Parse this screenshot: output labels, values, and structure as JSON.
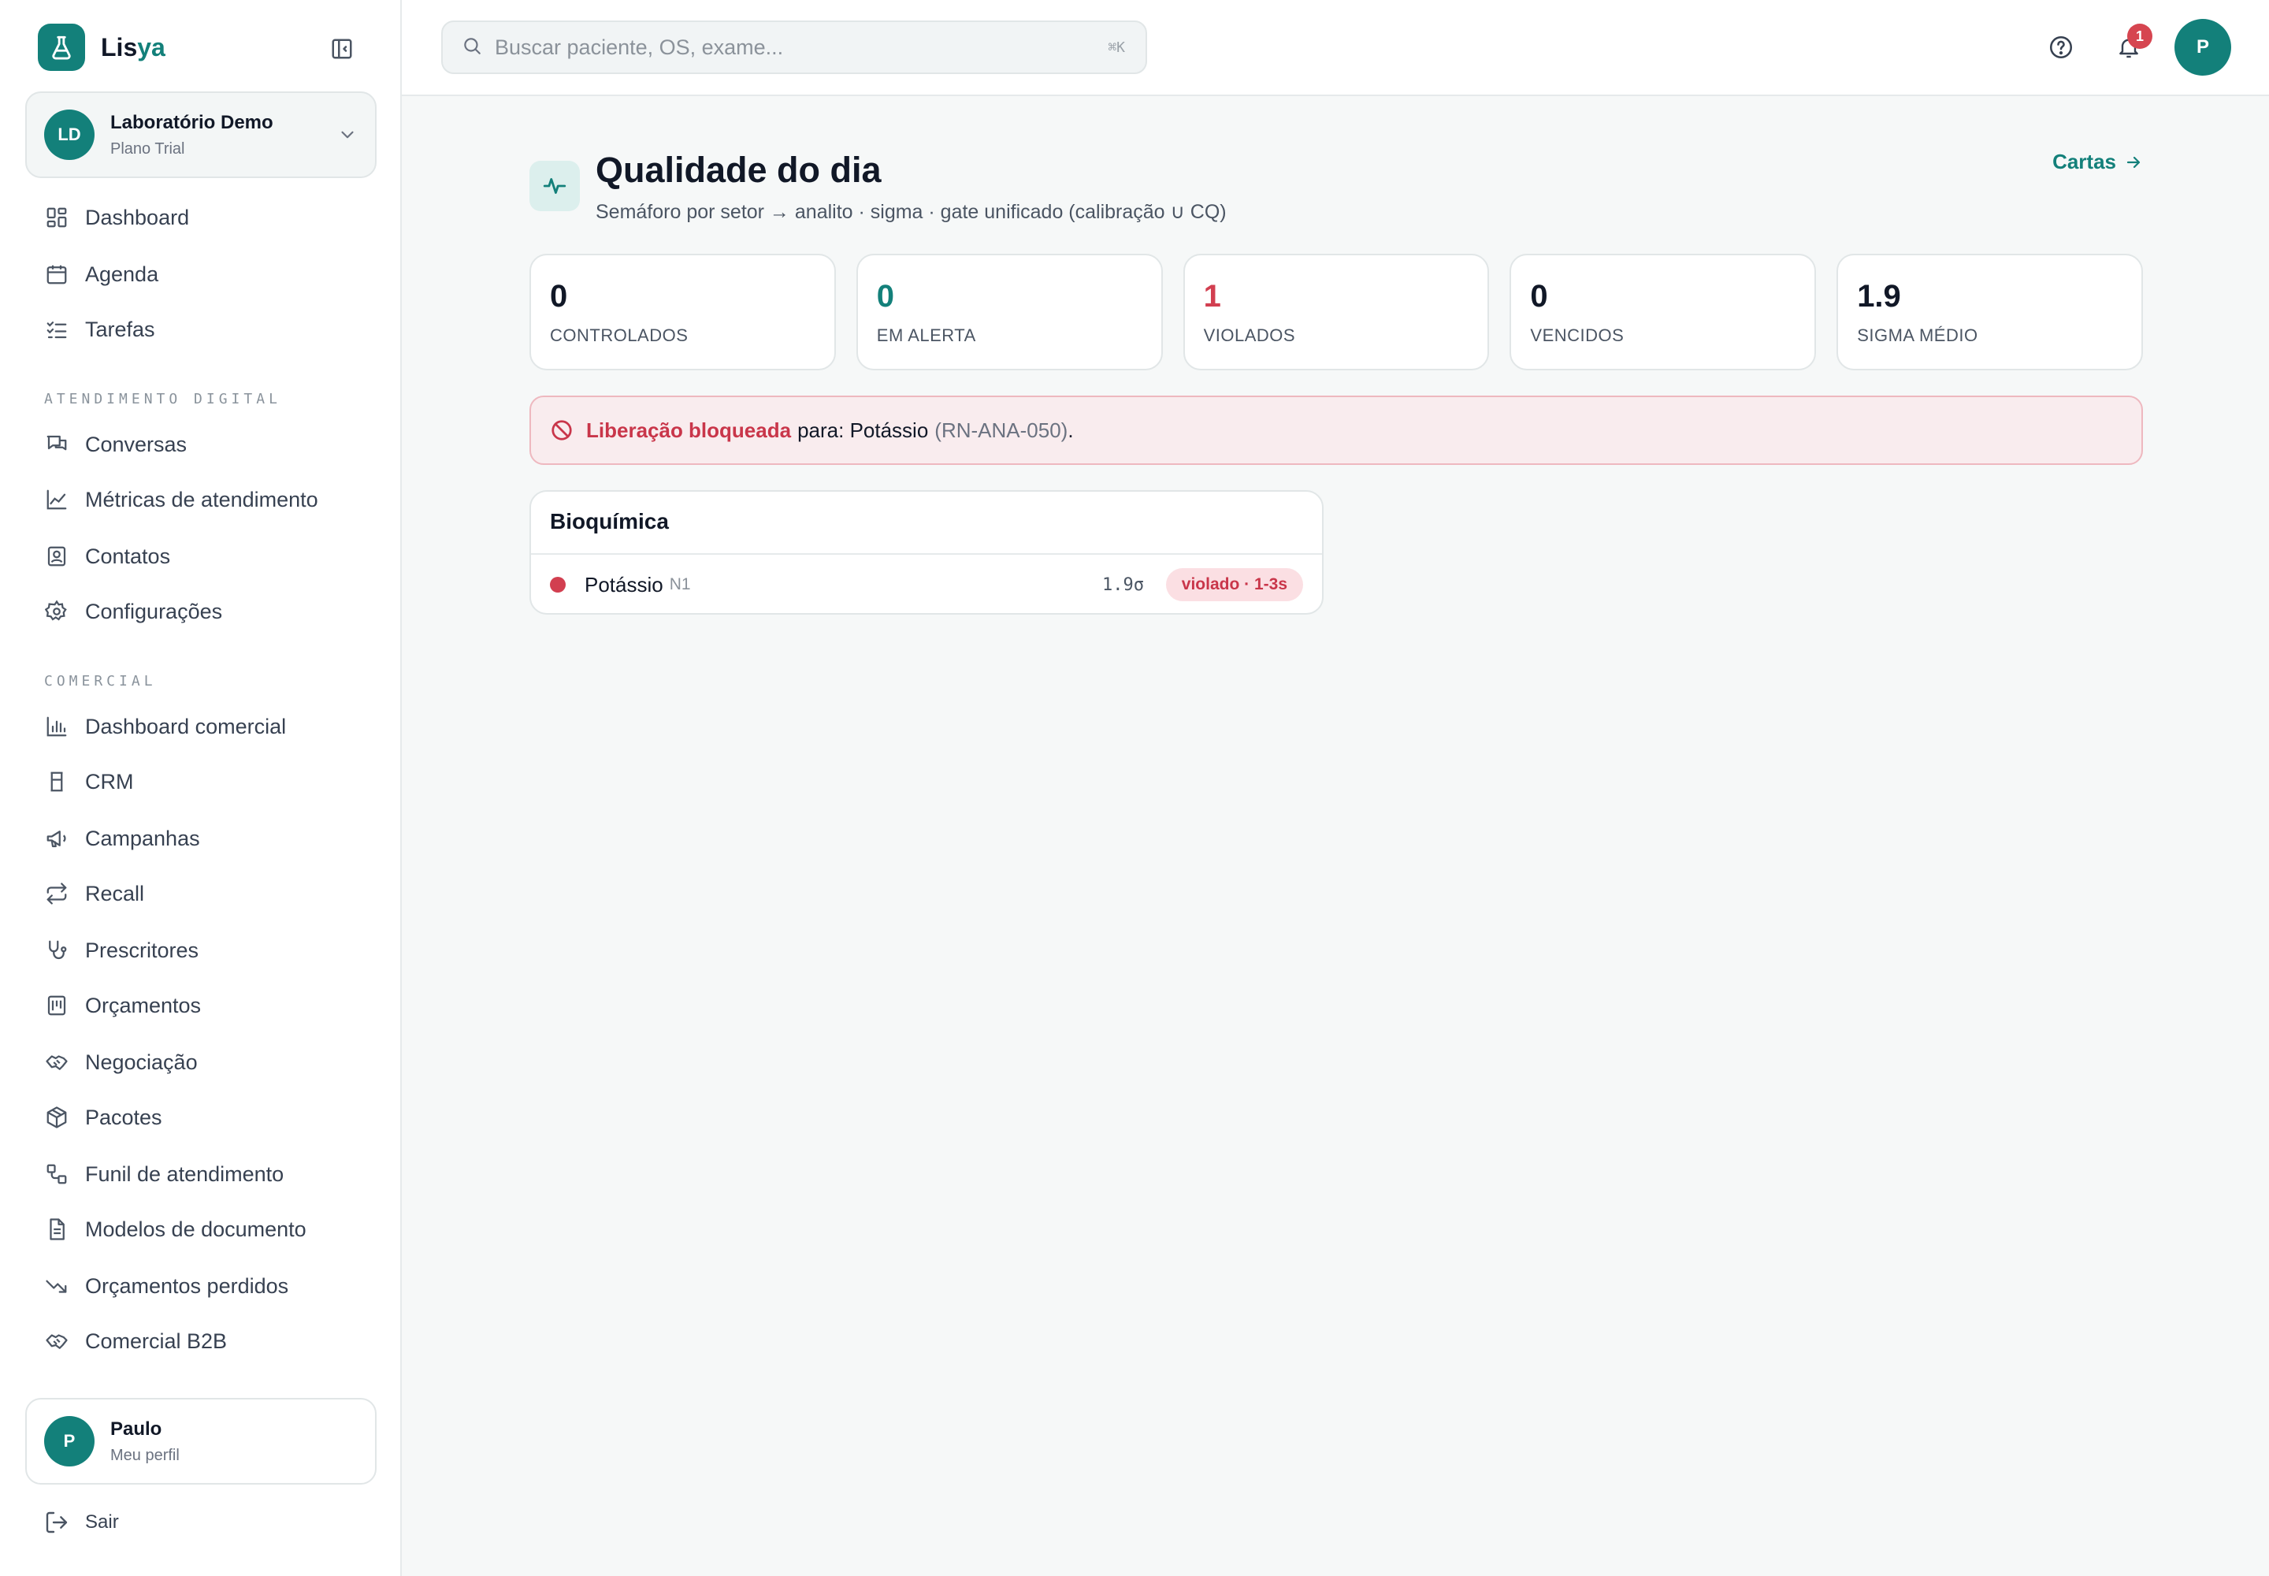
{
  "brand": {
    "name_part1": "Lis",
    "name_part2": "ya"
  },
  "org": {
    "initials": "LD",
    "name": "Laboratório Demo",
    "plan": "Plano Trial"
  },
  "nav": {
    "main": [
      {
        "label": "Dashboard",
        "icon": "dashboard-icon"
      },
      {
        "label": "Agenda",
        "icon": "calendar-icon"
      },
      {
        "label": "Tarefas",
        "icon": "checklist-icon"
      }
    ],
    "digital_title": "ATENDIMENTO DIGITAL",
    "digital": [
      {
        "label": "Conversas",
        "icon": "chat-icon"
      },
      {
        "label": "Métricas de atendimento",
        "icon": "line-chart-icon"
      },
      {
        "label": "Contatos",
        "icon": "contact-icon"
      },
      {
        "label": "Configurações",
        "icon": "gear-icon"
      }
    ],
    "commercial_title": "COMERCIAL",
    "commercial": [
      {
        "label": "Dashboard comercial",
        "icon": "bar-chart-icon"
      },
      {
        "label": "CRM",
        "icon": "crm-icon"
      },
      {
        "label": "Campanhas",
        "icon": "megaphone-icon"
      },
      {
        "label": "Recall",
        "icon": "repeat-icon"
      },
      {
        "label": "Prescritores",
        "icon": "stethoscope-icon"
      },
      {
        "label": "Orçamentos",
        "icon": "receipt-icon"
      },
      {
        "label": "Negociação",
        "icon": "handshake-icon"
      },
      {
        "label": "Pacotes",
        "icon": "package-icon"
      },
      {
        "label": "Funil de atendimento",
        "icon": "funnel-icon"
      },
      {
        "label": "Modelos de documento",
        "icon": "document-icon"
      },
      {
        "label": "Orçamentos perdidos",
        "icon": "trending-down-icon"
      },
      {
        "label": "Comercial B2B",
        "icon": "handshake-icon"
      }
    ]
  },
  "user": {
    "initial": "P",
    "name": "Paulo",
    "subtitle": "Meu perfil"
  },
  "logout_label": "Sair",
  "topbar": {
    "search_placeholder": "Buscar paciente, OS, exame...",
    "shortcut": "⌘K",
    "notifications": "1",
    "avatar_initial": "P"
  },
  "page": {
    "title": "Qualidade do dia",
    "subtitle": "Semáforo por setor → analito · sigma · gate unificado (calibração ∪ CQ)",
    "cartas_link": "Cartas"
  },
  "kpis": [
    {
      "value": "0",
      "label": "CONTROLADOS",
      "color": "#111827"
    },
    {
      "value": "0",
      "label": "EM ALERTA",
      "color": "#13807a"
    },
    {
      "value": "1",
      "label": "VIOLADOS",
      "color": "#d23f50"
    },
    {
      "value": "0",
      "label": "VENCIDOS",
      "color": "#111827"
    },
    {
      "value": "1.9",
      "label": "SIGMA MÉDIO",
      "color": "#111827"
    }
  ],
  "alert": {
    "strong": "Liberação bloqueada",
    "middle": "para: Potássio",
    "code": "(RN-ANA-050)",
    "end": "."
  },
  "sector": {
    "name": "Bioquímica",
    "rows": [
      {
        "analyte": "Potássio",
        "level": "N1",
        "sigma": "1.9σ",
        "status": "violado · 1-3s",
        "status_color": "#d23f50"
      }
    ]
  },
  "colors": {
    "accent": "#13807a",
    "danger": "#d23f50"
  }
}
